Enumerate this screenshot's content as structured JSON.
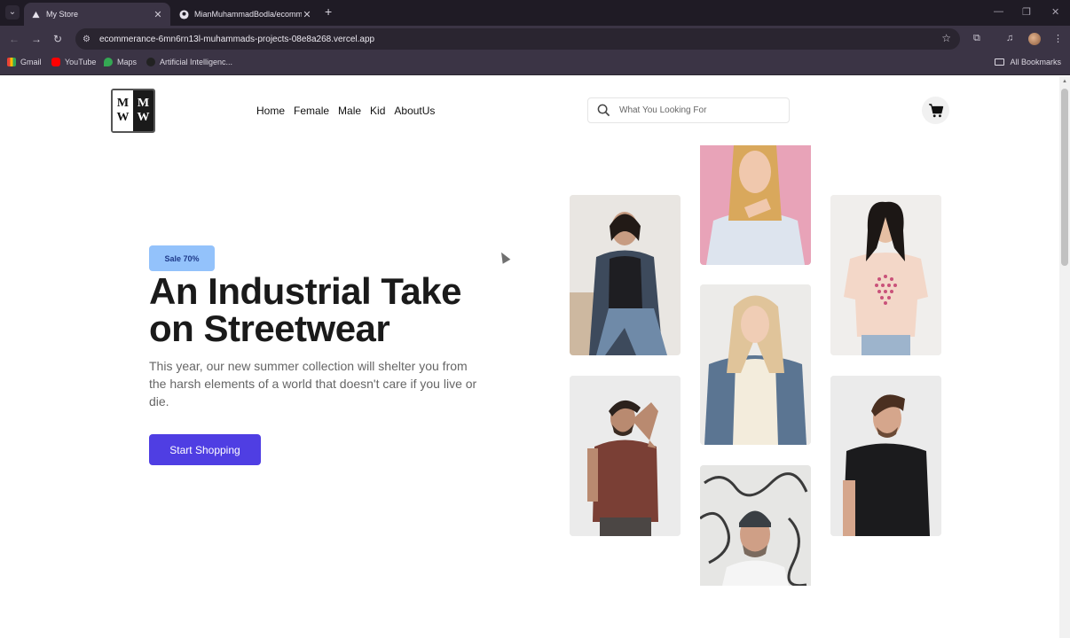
{
  "browser": {
    "tabs": [
      {
        "title": "My Store",
        "active": true
      },
      {
        "title": "MianMuhammadBodla/ecomm",
        "active": false
      }
    ],
    "url": "ecommerance-6mn6rn13l-muhammads-projects-08e8a268.vercel.app",
    "bookmarks": [
      {
        "label": "Gmail",
        "icon": "gmail-icon"
      },
      {
        "label": "YouTube",
        "icon": "youtube-icon"
      },
      {
        "label": "Maps",
        "icon": "maps-icon"
      },
      {
        "label": "Artificial Intelligenc...",
        "icon": "ai-icon"
      }
    ],
    "all_bookmarks": "All Bookmarks"
  },
  "header": {
    "logo_letters": [
      "M",
      "M",
      "W",
      "W"
    ],
    "nav": [
      "Home",
      "Female",
      "Male",
      "Kid",
      "AboutUs"
    ],
    "search_placeholder": "What You Looking For"
  },
  "hero": {
    "badge": "Sale 70%",
    "title_line1": "An Industrial Take",
    "title_line2": "on Streetwear",
    "description": "This year, our new summer collection will shelter you from the harsh elements of a world that doesn't care if you live or die.",
    "cta": "Start Shopping"
  },
  "colors": {
    "accent": "#4f3ee3",
    "badge_bg": "#93c2fb",
    "chrome_dark": "#1f1b25",
    "chrome": "#3b3445"
  },
  "gallery": [
    {
      "name": "woman-denim-jacket",
      "bg": "#e9e6e2"
    },
    {
      "name": "woman-pink-bg",
      "bg": "#e8a3b8"
    },
    {
      "name": "woman-pink-tee",
      "bg": "#f0eeec"
    },
    {
      "name": "man-brown-tee",
      "bg": "#ebebeb"
    },
    {
      "name": "woman-denim-white",
      "bg": "#ecebe9"
    },
    {
      "name": "man-black-tee",
      "bg": "#ebebeb"
    },
    {
      "name": "man-beanie",
      "bg": "#e6e6e4"
    }
  ]
}
